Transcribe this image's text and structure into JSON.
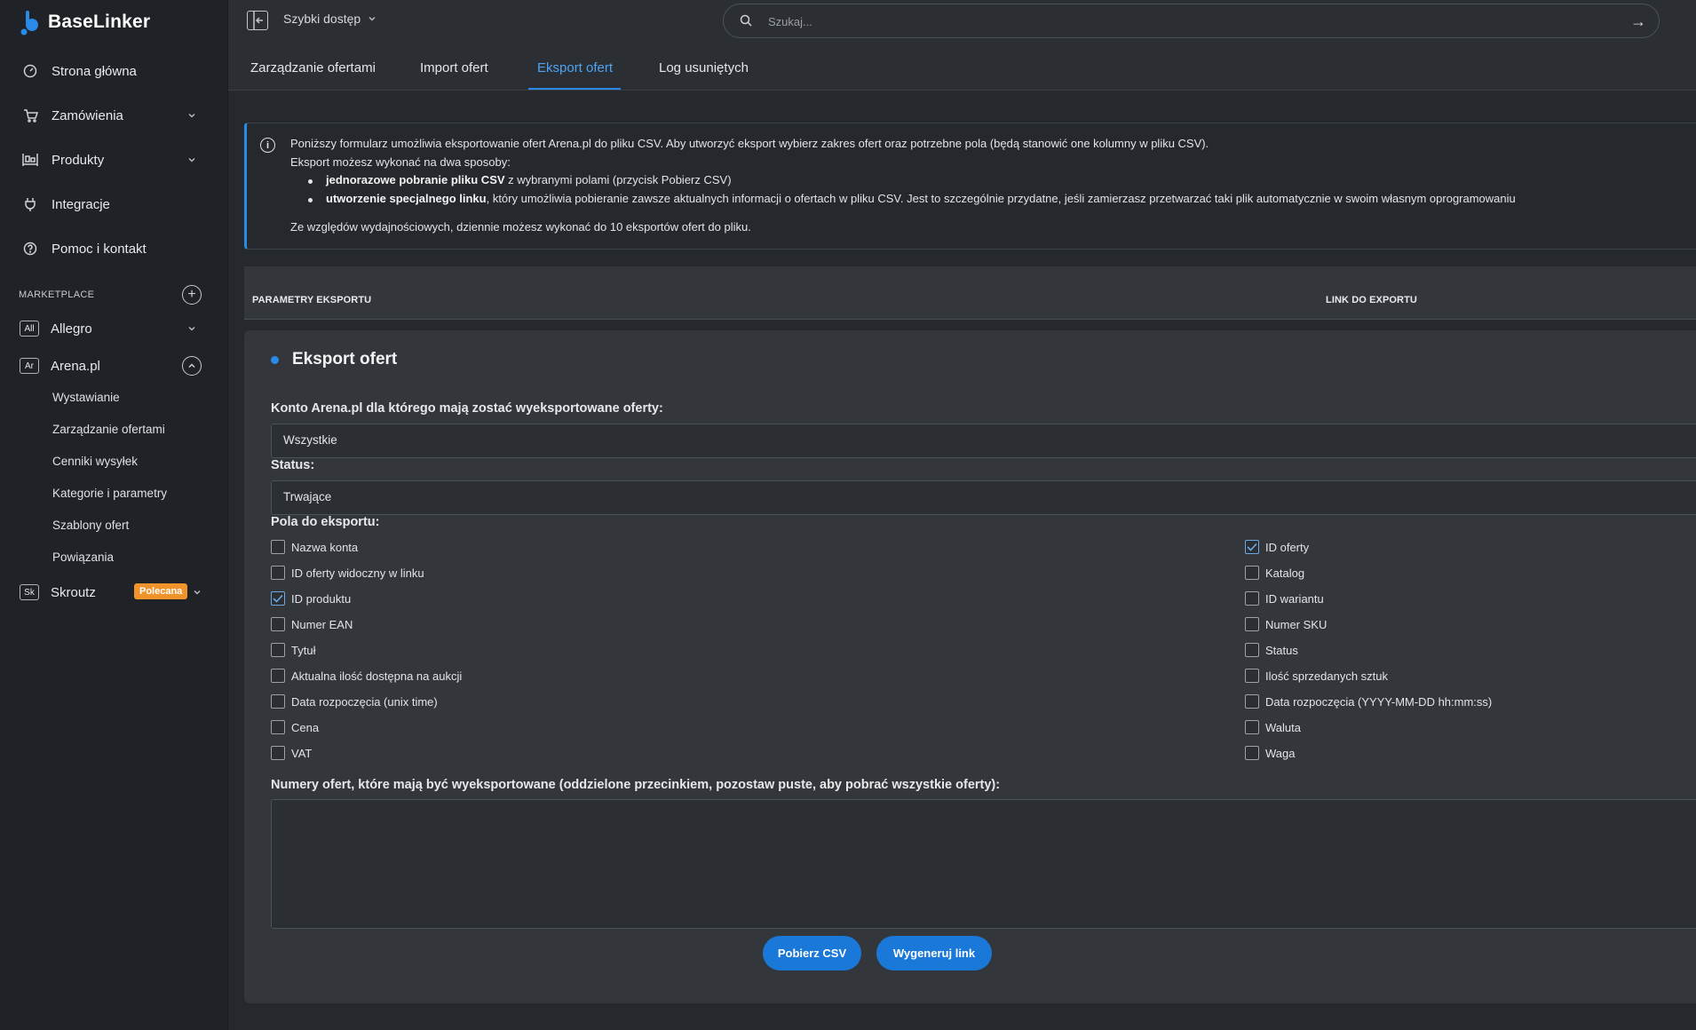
{
  "app": {
    "name": "BaseLinker"
  },
  "sidebar": {
    "nav": [
      {
        "label": "Strona główna",
        "icon": "dashboard-icon"
      },
      {
        "label": "Zamówienia",
        "icon": "cart-icon"
      },
      {
        "label": "Produkty",
        "icon": "products-icon"
      },
      {
        "label": "Integracje",
        "icon": "plug-icon"
      },
      {
        "label": "Pomoc i kontakt",
        "icon": "help-icon"
      }
    ],
    "marketplace_label": "MARKETPLACE",
    "marketplaces": [
      {
        "badge": "All",
        "label": "Allegro"
      },
      {
        "badge": "Ar",
        "label": "Arena.pl"
      },
      {
        "badge": "Sk",
        "label": "Skroutz",
        "tag": "Polecana"
      }
    ],
    "arena_subitems": [
      "Wystawianie",
      "Zarządzanie ofertami",
      "Cenniki wysyłek",
      "Kategorie i parametry",
      "Szablony ofert",
      "Powiązania"
    ]
  },
  "topbar": {
    "quick_access": "Szybki dostęp",
    "search_placeholder": "Szukaj..."
  },
  "tabs": [
    "Zarządzanie ofertami",
    "Import ofert",
    "Eksport ofert",
    "Log usuniętych"
  ],
  "active_tab": "Eksport ofert",
  "info": {
    "line1": "Poniższy formularz umożliwia eksportowanie ofert Arena.pl do pliku CSV. Aby utworzyć eksport wybierz zakres ofert oraz potrzebne pola (będą stanowić one kolumny w pliku CSV).",
    "line2": "Eksport możesz wykonać na dwa sposoby:",
    "b1_bold": "jednorazowe pobranie pliku CSV",
    "b1_rest": " z wybranymi polami (przycisk Pobierz CSV)",
    "b2_bold": "utworzenie specjalnego linku",
    "b2_rest": ", który umożliwia pobieranie zawsze aktualnych informacji o ofertach w pliku CSV. Jest to szczególnie przydatne, jeśli zamierzasz przetwarzać taki plik automatycznie w swoim własnym oprogramowaniu",
    "line3": "Ze względów wydajnościowych, dziennie możesz wykonać do 10 eksportów ofert do pliku."
  },
  "params_bar": {
    "left": "PARAMETRY EKSPORTU",
    "right": "LINK DO EXPORTU"
  },
  "form": {
    "title": "Eksport ofert",
    "account_label": "Konto Arena.pl dla którego mają zostać wyeksportowane oferty:",
    "account_value": "Wszystkie",
    "status_label": "Status:",
    "status_value": "Trwające",
    "fields_label": "Pola do eksportu:",
    "fields_left": [
      {
        "label": "Nazwa konta",
        "checked": false
      },
      {
        "label": "ID oferty widoczny w linku",
        "checked": false
      },
      {
        "label": "ID produktu",
        "checked": true
      },
      {
        "label": "Numer EAN",
        "checked": false
      },
      {
        "label": "Tytuł",
        "checked": false
      },
      {
        "label": "Aktualna ilość dostępna na aukcji",
        "checked": false
      },
      {
        "label": "Data rozpoczęcia (unix time)",
        "checked": false
      },
      {
        "label": "Cena",
        "checked": false
      },
      {
        "label": "VAT",
        "checked": false
      }
    ],
    "fields_right": [
      {
        "label": "ID oferty",
        "checked": true
      },
      {
        "label": "Katalog",
        "checked": false
      },
      {
        "label": "ID wariantu",
        "checked": false
      },
      {
        "label": "Numer SKU",
        "checked": false
      },
      {
        "label": "Status",
        "checked": false
      },
      {
        "label": "Ilość sprzedanych sztuk",
        "checked": false
      },
      {
        "label": "Data rozpoczęcia (YYYY-MM-DD hh:mm:ss)",
        "checked": false
      },
      {
        "label": "Waluta",
        "checked": false
      },
      {
        "label": "Waga",
        "checked": false
      }
    ],
    "numbers_label": "Numery ofert, które mają być wyeksportowane (oddzielone przecinkiem, pozostaw puste, aby pobrać wszystkie oferty):",
    "numbers_value": "",
    "btn_csv": "Pobierz CSV",
    "btn_link": "Wygeneruj link"
  },
  "colors": {
    "accent": "#2a8ae8",
    "badge": "#f0932a",
    "sidebar": "#1f2226",
    "card": "#33373c"
  }
}
